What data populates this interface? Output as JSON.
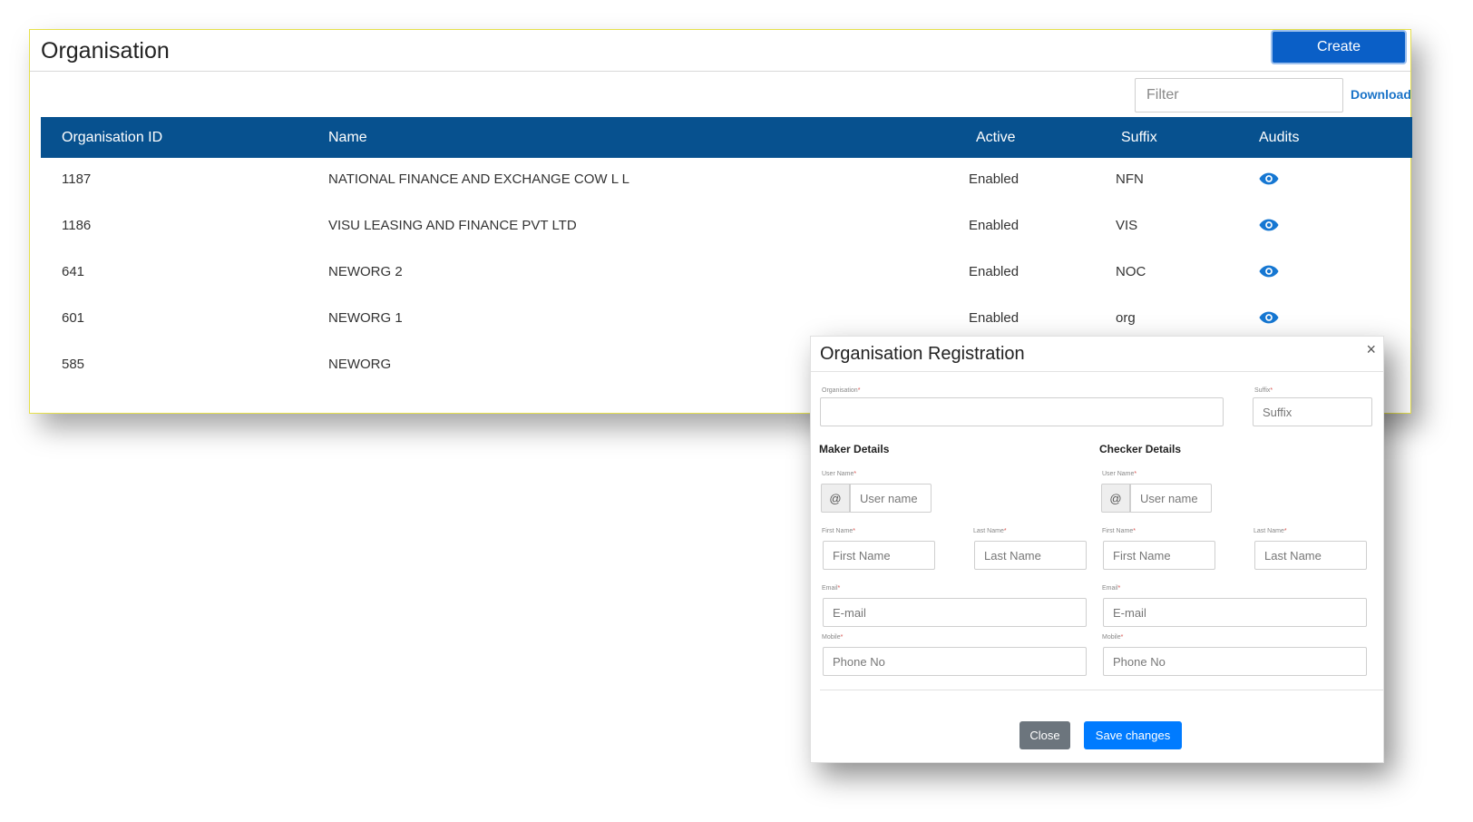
{
  "organisation": {
    "title": "Organisation",
    "create_label": "Create",
    "filter_placeholder": "Filter",
    "download_label": "Download",
    "columns": [
      "Organisation ID",
      "Name",
      "Active",
      "Suffix",
      "Audits"
    ],
    "rows": [
      {
        "id": "1187",
        "name": "NATIONAL FINANCE AND EXCHANGE COW L L",
        "active": "Enabled",
        "suffix": "NFN"
      },
      {
        "id": "1186",
        "name": "VISU LEASING AND FINANCE PVT LTD",
        "active": "Enabled",
        "suffix": "VIS"
      },
      {
        "id": "641",
        "name": "NEWORG 2",
        "active": "Enabled",
        "suffix": "NOC"
      },
      {
        "id": "601",
        "name": "NEWORG 1",
        "active": "Enabled",
        "suffix": "org"
      },
      {
        "id": "585",
        "name": "NEWORG",
        "active": "",
        "suffix": ""
      }
    ],
    "audit_icon": "eye-icon",
    "accent_color": "#07518f"
  },
  "modal": {
    "title": "Organisation Registration",
    "close_x": "×",
    "organisation_label": "Organisation",
    "suffix_label": "Suffix",
    "suffix_placeholder": "Suffix",
    "required_mark": "*",
    "maker": {
      "title": "Maker Details",
      "username_label": "User Name",
      "username_placeholder": "User name",
      "at_symbol": "@",
      "firstname_label": "First Name",
      "firstname_placeholder": "First Name",
      "lastname_label": "Last Name",
      "lastname_placeholder": "Last Name",
      "email_label": "Email",
      "email_placeholder": "E-mail",
      "mobile_label": "Mobile",
      "mobile_placeholder": "Phone No"
    },
    "checker": {
      "title": "Checker Details",
      "username_label": "User Name",
      "username_placeholder": "User name",
      "at_symbol": "@",
      "firstname_label": "First Name",
      "firstname_placeholder": "First Name",
      "lastname_label": "Last Name",
      "lastname_placeholder": "Last Name",
      "email_label": "Email",
      "email_placeholder": "E-mail",
      "mobile_label": "Mobile",
      "mobile_placeholder": "Phone No"
    },
    "close_label": "Close",
    "save_label": "Save changes"
  }
}
